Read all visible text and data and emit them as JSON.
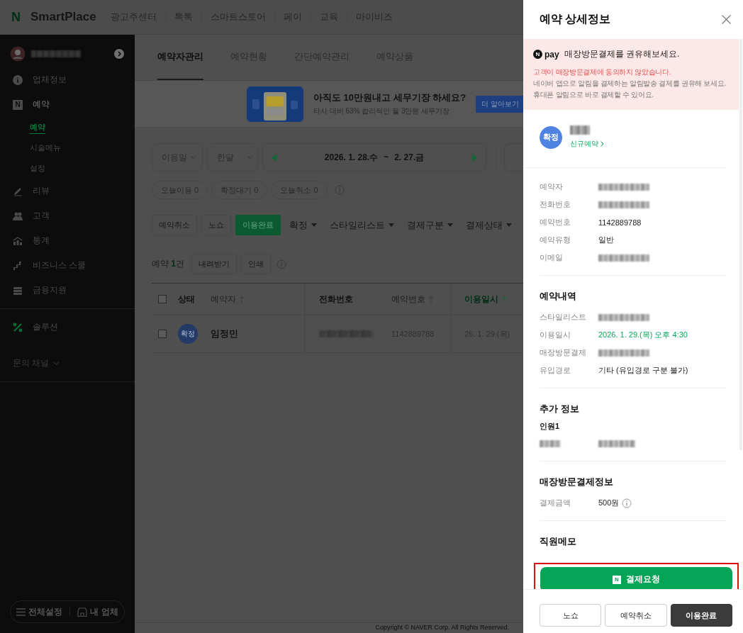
{
  "top_bar": {
    "logo_mark": "N",
    "logo_text": "SmartPlace",
    "nav": [
      "광고주센터",
      "톡톡",
      "스마트스토어",
      "페이",
      "교육",
      "마이비즈"
    ]
  },
  "sidebar": {
    "sections": [
      {
        "items": [
          {
            "label": "업체정보",
            "kind": "menu",
            "selected": false
          },
          {
            "label": "예약",
            "kind": "menu",
            "icon_text": "N",
            "selected": false,
            "expanded": true,
            "children": [
              {
                "label": "예약",
                "selected": true
              },
              {
                "label": "시술메뉴",
                "selected": false
              },
              {
                "label": "설정",
                "selected": false
              }
            ]
          },
          {
            "label": "리뷰",
            "kind": "menu",
            "selected": false
          },
          {
            "label": "고객",
            "kind": "menu",
            "selected": false
          },
          {
            "label": "통계",
            "kind": "menu",
            "selected": false
          },
          {
            "label": "비즈니스 스쿨",
            "kind": "menu",
            "selected": false
          },
          {
            "label": "금융지원",
            "kind": "menu",
            "selected": false
          }
        ]
      },
      {
        "items": [
          {
            "label": "솔루션",
            "kind": "menu",
            "selected": false
          }
        ]
      },
      {
        "items": [
          {
            "label": "문의 채널",
            "kind": "dropdown",
            "selected": false
          }
        ]
      }
    ],
    "footer_buttons": [
      "전체설정",
      "내 업체"
    ]
  },
  "tabs": [
    {
      "label": "예약자관리",
      "selected": true
    },
    {
      "label": "예약현황",
      "selected": false
    },
    {
      "label": "간단예약관리",
      "selected": false
    },
    {
      "label": "예약상품",
      "selected": false
    }
  ],
  "banner": {
    "title": "아직도 10만원내고 세무기장 하세요?",
    "subtitle": "타사 대비 63% 합리적인 월 3만원 세무기장",
    "button": "더 알아보기"
  },
  "filters": {
    "selects": [
      "이용일",
      "한달"
    ],
    "date_start": "2026. 1. 28.수",
    "date_sep": "~",
    "date_end": "2. 27.금",
    "chips": [
      "오늘이용 0",
      "확정대기 0",
      "오늘취소 0"
    ]
  },
  "actions": [
    {
      "label": "예약취소",
      "kind": "button"
    },
    {
      "label": "노쇼",
      "kind": "button"
    },
    {
      "label": "이용완료",
      "kind": "primary"
    },
    {
      "label": "확정",
      "kind": "dropdown"
    },
    {
      "label": "스타일리스트",
      "kind": "dropdown"
    },
    {
      "label": "결제구분",
      "kind": "dropdown"
    },
    {
      "label": "결제상태",
      "kind": "dropdown"
    }
  ],
  "summary": {
    "label": "예약",
    "count": "1",
    "unit": "건",
    "buttons": [
      "내려받기",
      "인쇄"
    ]
  },
  "table": {
    "select_all": false,
    "columns": [
      {
        "label": "상태",
        "sortable": false,
        "sorted": false
      },
      {
        "label": "예약자",
        "sortable": true,
        "sorted": false
      },
      {
        "label": "전화번호",
        "sortable": false,
        "sorted": false
      },
      {
        "label": "예약번호",
        "sortable": true,
        "sorted": false
      },
      {
        "label": "이용일시",
        "sortable": true,
        "sorted": true
      }
    ],
    "rows": [
      {
        "selected": false,
        "status": "확정",
        "name": "임정민",
        "number": "1142889788",
        "datetime": "26. 1. 29.(목)"
      }
    ]
  },
  "footer": {
    "copyright": "Copyright © NAVER Corp. All Rights Reserved."
  },
  "drawer": {
    "title": "예약 상세정보",
    "notice": {
      "logo_mark": "N",
      "logo_word": "pay",
      "headline": "매장방문결제를 권유해보세요.",
      "warning": "고객이 매장방문결제에 동의하지 않았습니다.",
      "body": [
        "네이버 앱으로 알림을 결제하는 알림발송 결제를 권유해 보세요.",
        "휴대폰 알림으로 바로 결제할 수 있어요."
      ]
    },
    "profile": {
      "status": "확정",
      "link": "신규예약"
    },
    "info_rows": [
      {
        "label": "예약자",
        "kind": "redacted"
      },
      {
        "label": "전화번호",
        "kind": "redacted"
      },
      {
        "label": "예약번호",
        "kind": "text",
        "value": "1142889788"
      },
      {
        "label": "예약유형",
        "kind": "text",
        "value": "일반"
      },
      {
        "label": "이메일",
        "kind": "redacted"
      }
    ],
    "sections": [
      {
        "title": "예약내역",
        "rows": [
          {
            "label": "스타일리스트",
            "kind": "redacted"
          },
          {
            "label": "이용일시",
            "kind": "highlight",
            "value": "2026. 1. 29.(목) 오후 4:30"
          },
          {
            "label": "매장방문결제",
            "kind": "redacted"
          },
          {
            "label": "유입경로",
            "kind": "text",
            "value": "기타 (유입경로 구분 불가)"
          }
        ]
      },
      {
        "title": "추가 정보",
        "subtitle": "인원1",
        "rows": [
          {
            "kind": "redacted_pair"
          }
        ]
      },
      {
        "title": "매장방문결제정보",
        "rows": [
          {
            "label": "결제금액",
            "kind": "info",
            "value": "500원"
          }
        ]
      },
      {
        "title": "직원메모"
      }
    ],
    "pay_button": {
      "icon_text": "N",
      "label": "결제요청",
      "highlighted": true
    },
    "footer_buttons": [
      {
        "label": "노쇼",
        "kind": "outline"
      },
      {
        "label": "예약취소",
        "kind": "outline"
      },
      {
        "label": "이용완료",
        "kind": "dark"
      }
    ]
  }
}
